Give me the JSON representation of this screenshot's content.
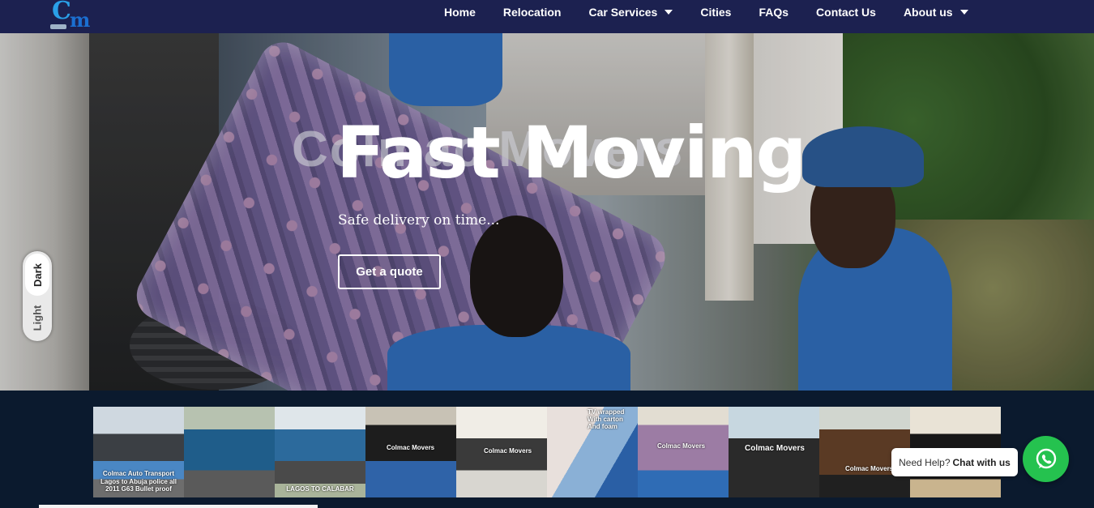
{
  "brand": {
    "logo_letters": "Cm"
  },
  "nav": {
    "items": [
      {
        "label": "Home",
        "dropdown": false
      },
      {
        "label": "Relocation",
        "dropdown": false
      },
      {
        "label": "Car Services",
        "dropdown": true
      },
      {
        "label": "Cities",
        "dropdown": false
      },
      {
        "label": "FAQs",
        "dropdown": false
      },
      {
        "label": "Contact Us",
        "dropdown": false
      },
      {
        "label": "About us",
        "dropdown": true
      }
    ]
  },
  "hero": {
    "watermark": "Colmac Movers",
    "title": "Fast Moving",
    "subtitle": "Safe delivery on time...",
    "cta_label": "Get a quote"
  },
  "theme_toggle": {
    "dark_label": "Dark",
    "light_label": "Light",
    "selected": "Dark"
  },
  "gallery": {
    "items": [
      {
        "caption": "Colmac Auto Transport Lagos to Abuja police all 2011 G63 Bullet proof"
      },
      {
        "caption": ""
      },
      {
        "caption": "LAGOS TO CALABAR"
      },
      {
        "caption": "Colmac Movers"
      },
      {
        "caption": "Colmac Movers"
      },
      {
        "caption": "TV wrapped With carton And foam"
      },
      {
        "caption": "Colmac Movers"
      },
      {
        "caption": "Colmac Movers"
      },
      {
        "caption": "Colmac Movers"
      },
      {
        "caption": ""
      }
    ]
  },
  "chat": {
    "prefix": "Need Help?",
    "action": "Chat with us",
    "icon": "whatsapp-icon"
  },
  "colors": {
    "nav_bg": "#1c2150",
    "band_bg": "#0b1a2e",
    "whatsapp_green": "#25c24f",
    "worker_shirt": "#2f6cb5"
  }
}
